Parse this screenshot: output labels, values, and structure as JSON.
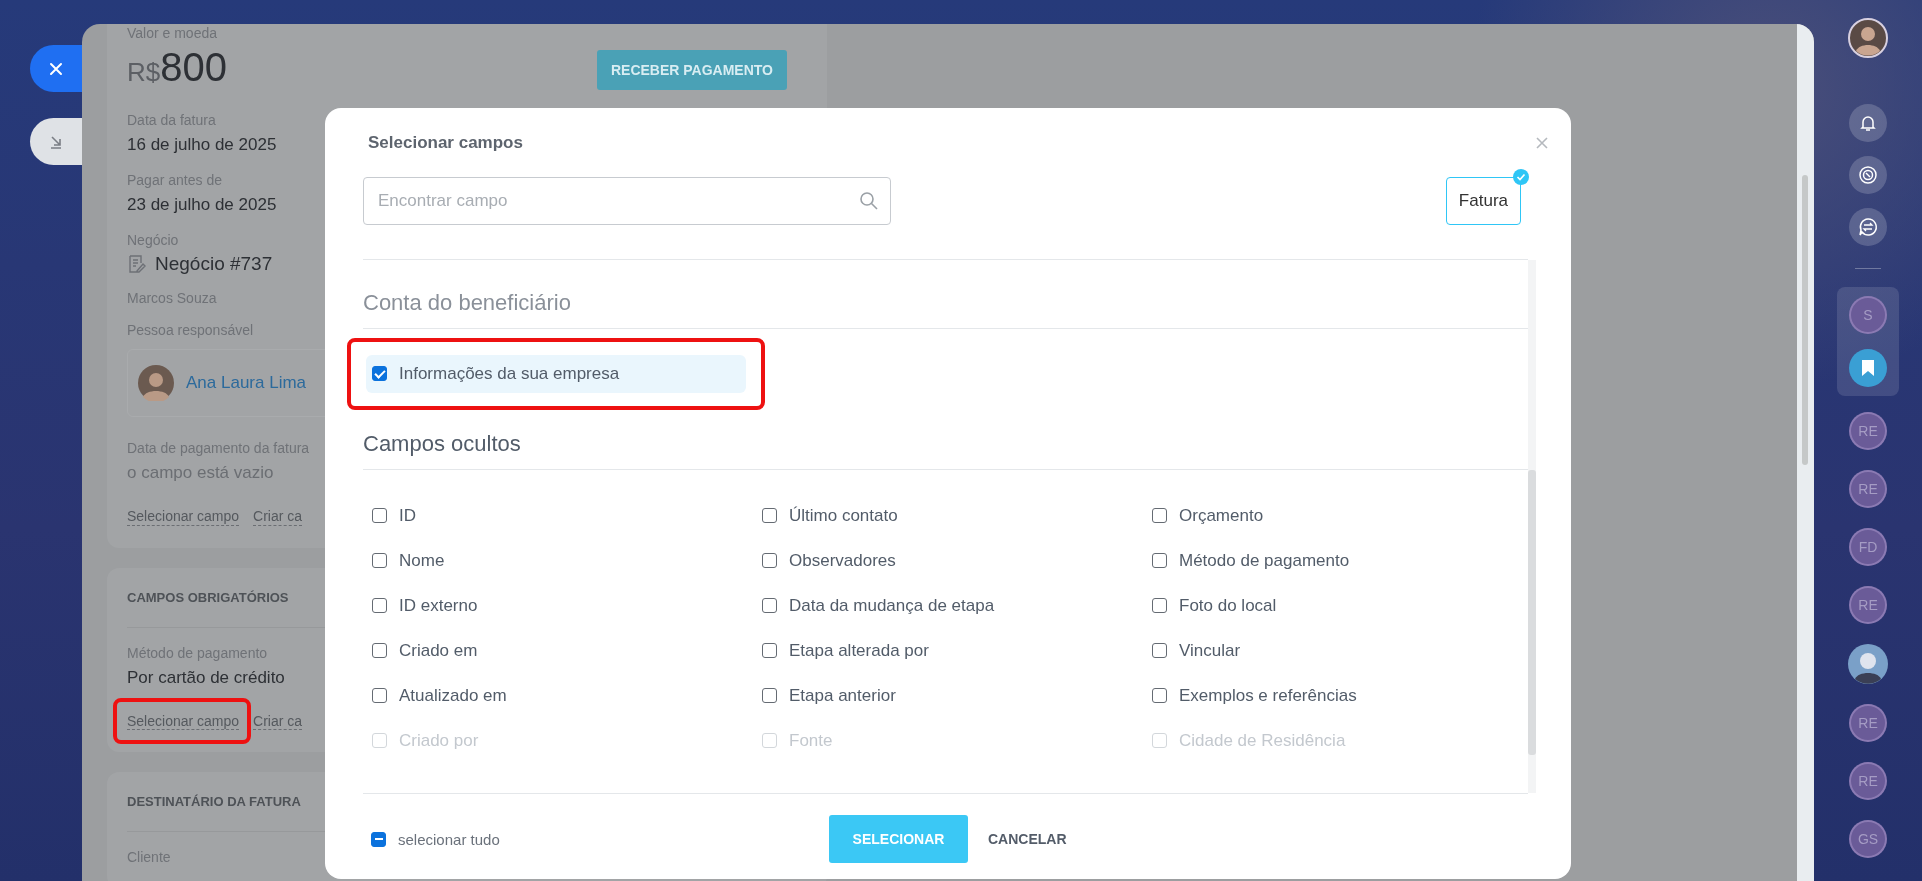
{
  "deal_panel": {
    "amount_label": "Valor e moeda",
    "currency": "R$",
    "amount": "800",
    "receive_button": "RECEBER PAGAMENTO",
    "invoice_date": {
      "label": "Data da fatura",
      "value": "16 de julho de 2025"
    },
    "due_date": {
      "label": "Pagar antes de",
      "value": "23 de julho de 2025"
    },
    "deal": {
      "label": "Negócio",
      "value": "Negócio #737"
    },
    "contact_name": "Marcos Souza",
    "responsible": {
      "label": "Pessoa responsável",
      "name": "Ana Laura Lima"
    },
    "payment_date": {
      "label": "Data de pagamento da fatura",
      "value": "o campo está vazio"
    },
    "links": [
      "Selecionar campo",
      "Criar ca"
    ]
  },
  "required_fields": {
    "heading": "CAMPOS OBRIGATÓRIOS",
    "label": "Método de pagamento",
    "value": "Por cartão de crédito",
    "links": [
      "Selecionar campo",
      "Criar ca"
    ]
  },
  "invoice_recipient": {
    "heading": "DESTINATÁRIO DA FATURA",
    "label": "Cliente"
  },
  "modal": {
    "title": "Selecionar campos",
    "search": {
      "placeholder": "Encontrar campo"
    },
    "entity_chip": {
      "label": "Fatura",
      "selected": true
    },
    "beneficiary_section": {
      "heading": "Conta do beneficiário",
      "fields": [
        {
          "label": "Informações da sua empresa",
          "checked": true,
          "selected": true
        }
      ]
    },
    "hidden_section": {
      "heading": "Campos ocultos",
      "fields": [
        {
          "label": "ID",
          "checked": false,
          "disabled": false
        },
        {
          "label": "Último contato",
          "checked": false,
          "disabled": false
        },
        {
          "label": "Orçamento",
          "checked": false,
          "disabled": false
        },
        {
          "label": "Nome",
          "checked": false,
          "disabled": false
        },
        {
          "label": "Observadores",
          "checked": false,
          "disabled": false
        },
        {
          "label": "Método de pagamento",
          "checked": false,
          "disabled": false
        },
        {
          "label": "ID externo",
          "checked": false,
          "disabled": false
        },
        {
          "label": "Data da mudança de etapa",
          "checked": false,
          "disabled": false
        },
        {
          "label": "Foto do local",
          "checked": false,
          "disabled": false
        },
        {
          "label": "Criado em",
          "checked": false,
          "disabled": false
        },
        {
          "label": "Etapa alterada por",
          "checked": false,
          "disabled": false
        },
        {
          "label": "Vincular",
          "checked": false,
          "disabled": false
        },
        {
          "label": "Atualizado em",
          "checked": false,
          "disabled": false
        },
        {
          "label": "Etapa anterior",
          "checked": false,
          "disabled": false
        },
        {
          "label": "Exemplos e referências",
          "checked": false,
          "disabled": false
        },
        {
          "label": "Criado por",
          "checked": false,
          "disabled": true
        },
        {
          "label": "Fonte",
          "checked": false,
          "disabled": true
        },
        {
          "label": "Cidade de Residência",
          "checked": false,
          "disabled": true
        }
      ]
    },
    "select_all": {
      "label": "selecionar tudo",
      "indeterminate": true
    },
    "buttons": [
      "SELECIONAR",
      "CANCELAR"
    ]
  },
  "sidebar": {
    "pinned": [
      {
        "kind": "initials",
        "initials": "S"
      },
      {
        "kind": "bookmark"
      }
    ],
    "chats": [
      {
        "kind": "initials",
        "initials": "RE"
      },
      {
        "kind": "initials",
        "initials": "RE"
      },
      {
        "kind": "initials",
        "initials": "FD"
      },
      {
        "kind": "initials",
        "initials": "RE"
      },
      {
        "kind": "avatar"
      },
      {
        "kind": "initials",
        "initials": "RE"
      },
      {
        "kind": "initials",
        "initials": "RE"
      },
      {
        "kind": "initials",
        "initials": "GS"
      }
    ]
  }
}
